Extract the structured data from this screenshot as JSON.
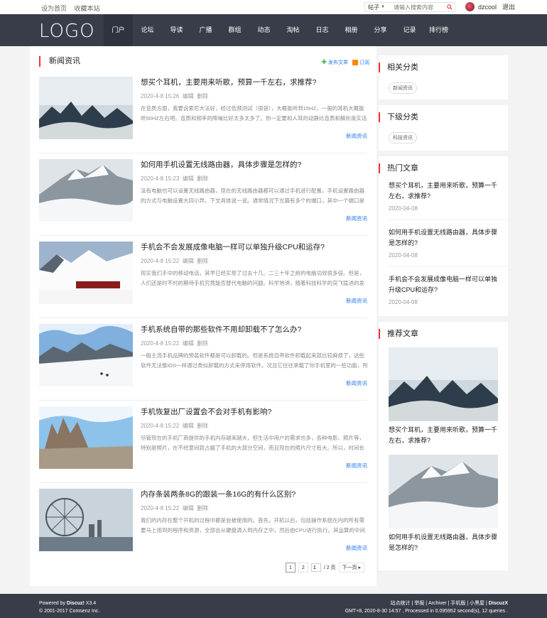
{
  "topbar": {
    "set_home": "设为首页",
    "bookmark": "收藏本站",
    "search_type": "帖子",
    "search_placeholder": "请输入搜索内容",
    "username": "dzcool",
    "logout": "退出"
  },
  "header": {
    "logo": "LOGO",
    "nav": [
      "门户",
      "论坛",
      "导读",
      "广播",
      "群组",
      "动态",
      "淘帖",
      "日志",
      "相册",
      "分享",
      "记录",
      "排行榜"
    ]
  },
  "main": {
    "title": "新闻资讯",
    "publish": "发布文章",
    "subscribe": "订阅",
    "articles": [
      {
        "title": "想买个耳机，主要用来听歌，预算一千左右，求推荐?",
        "date": "2020-4-8 15:26",
        "edit": "编辑",
        "delete": "删除",
        "summary": "在音质方面，我要说索尼大法好，经过低频测试（很容），大概能听到15HZ，一般的耳机大概能听50HZ左右吧。音质和频率的降噪比好太多太多了。你一定要和人耳的动静比音质和解析度实话实说不公平，你也可以去实体店体 ...",
        "category": "新闻资讯"
      },
      {
        "title": "如何用手机设置无线路由器，具体步骤是怎样的?",
        "date": "2020-4-8 15:23",
        "edit": "编辑",
        "delete": "删除",
        "summary": "没有电脑也可以设置无线路由器，现在的无线路由器都可以通过手机进行配置。手机设置路由器的方式与电脑设置大同小异。下文具体说一说。通常情况下光猫有多个的端口，其中一个端口是宽带上网端口，一个端口是IPTV端口 ...",
        "category": "新闻资讯"
      },
      {
        "title": "手机会不会发展成像电脑一样可以单独升级CPU和运存?",
        "date": "2020-4-8 15:22",
        "edit": "编辑",
        "delete": "删除",
        "summary": "现实我们手中的移动电话，其早已经实现了过去十几、二三十年之前的电脑功效很多倍。但是，人们还是时不时的期待手机究竟能否替代电脑的问题。科学地讲，随着科技科学的突飞猛进的发展，在个人PC的范围内，台式电脑 ...",
        "category": "新闻资讯"
      },
      {
        "title": "手机系统自带的那些软件不用却卸载不了怎么办?",
        "date": "2020-4-8 15:22",
        "edit": "编辑",
        "delete": "删除",
        "summary": "一般主流手机品牌的预装软件都是可以卸载的。但是系统自带软件卸载起来就比较麻烦了，这些软件无法像iOS一样通过类似卸载的方式来停用软件。况且它往往承载了你手机里的一些功能，所以卸载前建议先了解后依情组这一软 ...",
        "category": "新闻资讯"
      },
      {
        "title": "手机恢复出厂设置会不会对手机有影响?",
        "date": "2020-4-8 15:22",
        "edit": "编辑",
        "delete": "删除",
        "summary": "尽管现在的手机厂商提供的手机内存越来越大，但生活中用户的需求也多，各种电影、照片等，特别是照片，在不经意间就占据了手机的大部分空间，而且现在的照片尺寸有大。所以，时间长了，手机的存储空间就会出现不足的 ...",
        "category": "新闻资讯"
      },
      {
        "title": "内存条装两条8G的跟装一条16G的有什么区别?",
        "date": "2020-4-8 15:22",
        "edit": "编辑",
        "delete": "删除",
        "summary": "我们的内存在整个开机的过程中都是会被使用的。首先，开机以后，包括操作系统在内的所有需要马上用到的程序和资源，全部会从硬盘调入到内存之中，然后由CPU进行执行。其运算的中间结果也是会存储到内存之中的 ...",
        "category": "新闻资讯"
      }
    ],
    "pager": {
      "p1": "1",
      "p2": "2",
      "input": "1",
      "total": "/ 2 页",
      "next": "下一页"
    }
  },
  "sidebar": {
    "related_title": "相关分类",
    "related_tag": "新闻资讯",
    "sub_title": "下级分类",
    "sub_tag": "科技资讯",
    "hot_title": "热门文章",
    "hot": [
      {
        "title": "想买个耳机，主要用来听歌，预算一千左右，求推荐?",
        "date": "2020-04-08"
      },
      {
        "title": "如何用手机设置无线路由器，具体步骤是怎样的?",
        "date": "2020-04-08"
      },
      {
        "title": "手机会不会发展成像电脑一样可以单独升级CPU和运存?",
        "date": "2020-04-08"
      }
    ],
    "rec_title": "推荐文章",
    "rec": [
      {
        "title": "想买个耳机，主要用来听歌，预算一千左右，求推荐?"
      },
      {
        "title": "如何用手机设置无线路由器，具体步骤是怎样的?"
      }
    ]
  },
  "footer": {
    "powered_prefix": "Powered by ",
    "powered_brand": "Discuz!",
    "powered_ver": " X3.4",
    "copyright": "© 2001-2017 Comsenz Inc.",
    "links": "站点统计 | 举报 | Archiver | 手机版 | 小黑屋 | ",
    "links_brand": "DiscuzX",
    "status": "GMT+8, 2020-8-30 14:57 , Processed in 0.095952 second(s), 12 queries ."
  },
  "colors": {
    "nav_bg": "#393d49",
    "accent_red": "#e33",
    "link_blue": "#2a7ae2"
  }
}
